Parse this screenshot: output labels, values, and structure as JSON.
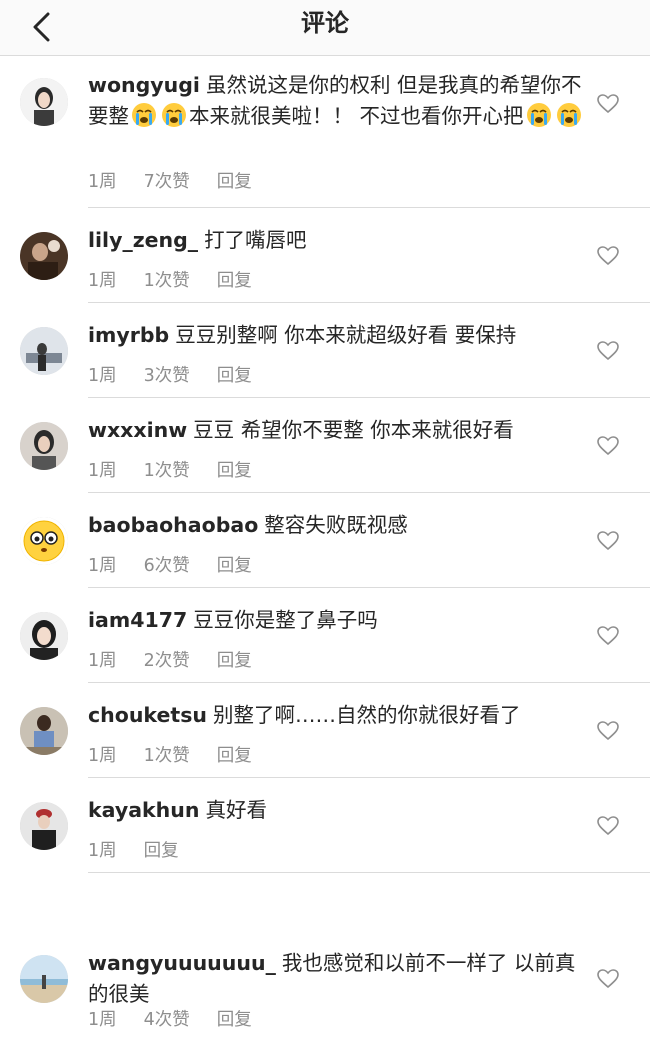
{
  "header": {
    "title": "评论"
  },
  "comments": [
    {
      "username": "wongyugi",
      "text_parts": [
        "虽然说这是你的权利 但是我真的希望你不要整",
        "本来就很美啦！！ 不过也看你开心把"
      ],
      "time": "1周",
      "likes": "7次赞",
      "reply": "回复"
    },
    {
      "username": "lily_zeng_",
      "text": "打了嘴唇吧",
      "time": "1周",
      "likes": "1次赞",
      "reply": "回复"
    },
    {
      "username": "imyrbb",
      "text": "豆豆别整啊 你本来就超级好看 要保持",
      "time": "1周",
      "likes": "3次赞",
      "reply": "回复"
    },
    {
      "username": "wxxxinw",
      "text": "豆豆 希望你不要整 你本来就很好看",
      "time": "1周",
      "likes": "1次赞",
      "reply": "回复"
    },
    {
      "username": "baobaohaobao",
      "text": "整容失败既视感",
      "time": "1周",
      "likes": "6次赞",
      "reply": "回复"
    },
    {
      "username": "iam4177",
      "text": "豆豆你是整了鼻子吗",
      "time": "1周",
      "likes": "2次赞",
      "reply": "回复"
    },
    {
      "username": "chouketsu",
      "text": "别整了啊……自然的你就很好看了",
      "time": "1周",
      "likes": "1次赞",
      "reply": "回复"
    },
    {
      "username": "kayakhun",
      "text": "真好看",
      "time": "1周",
      "reply": "回复"
    },
    {
      "username": "wangyuuuuuuu_",
      "text": "我也感觉和以前不一样了 以前真的很美",
      "time": "1周",
      "likes": "4次赞",
      "reply": "回复"
    }
  ],
  "icons": {
    "back": "chevron-left-icon",
    "heart": "heart-outline-icon",
    "emoji": "crying-face-emoji"
  },
  "colors": {
    "text": "#262626",
    "meta": "#8e8e8e",
    "divider": "#dbdbdb"
  }
}
